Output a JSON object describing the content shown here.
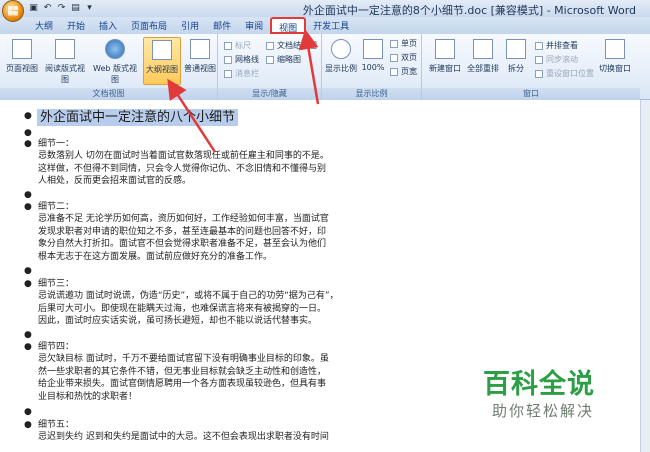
{
  "window": {
    "title": "外企面试中一定注意的8个小细节.doc [兼容模式] - Microsoft Word"
  },
  "ribbon_tabs": [
    "开始",
    "插入",
    "页面布局",
    "引用",
    "邮件",
    "审阅",
    "视图",
    "开发工具"
  ],
  "first_tab": "大纲",
  "active_tab": "视图",
  "groups": {
    "doc_views": {
      "label": "文档视图",
      "buttons": [
        "页面视图",
        "阅读版式视图",
        "Web 版式视图",
        "大纲视图",
        "普通视图"
      ],
      "selected": "大纲视图"
    },
    "show_hide": {
      "label": "显示/隐藏",
      "items": [
        "标尺",
        "网格线",
        "消息栏",
        "文档结构图",
        "缩略图"
      ]
    },
    "zoom": {
      "label": "显示比例",
      "buttons": [
        "显示比例",
        "100%"
      ],
      "small": [
        "单页",
        "双页",
        "页宽"
      ]
    },
    "window": {
      "label": "窗口",
      "buttons": [
        "新建窗口",
        "全部重排",
        "拆分",
        "切换窗口"
      ],
      "small": [
        "并排查看",
        "同步滚动",
        "重设窗口位置"
      ]
    }
  },
  "document": {
    "heading": "外企面试中一定注意的八个小细节",
    "sections": [
      {
        "title": "细节一：",
        "lines": [
          "忌数落别人  切勿在面试时当着面试官数落现任或前任雇主和同事的不是。",
          "这样做，不但得不到同情，只会令人觉得你记仇、不念旧情和不懂得与别",
          "人相处，反而更会招来面试官的反感。"
        ]
      },
      {
        "title": "细节二：",
        "lines": [
          "忌准备不足  无论学历如何高，资历如何好，工作经验如何丰富，当面试官",
          "发现求职者对申请的职位知之不多，甚至连最基本的问题也回答不好，印",
          "象分自然大打折扣。面试官不但会觉得求职者准备不足，甚至会认为他们",
          "根本无志于在这方面发展。面试前应做好充分的准备工作。"
        ]
      },
      {
        "title": "细节三：",
        "lines": [
          "忌说谎邀功  面试时说谎，伪造“历史”，或将不属于自己的功劳“据为己有”，",
          "后果可大可小。即使现在能瞒天过海，也难保谎言将来有被揭穿的一日。",
          "因此，面试时应实话实说，虽可扬长避短，却也不能以说话代替事实。"
        ]
      },
      {
        "title": "细节四：",
        "lines": [
          "忌欠缺目标  面试时，千万不要给面试官留下没有明确事业目标的印象。虽",
          "然一些求职者的其它条件不错，但无事业目标就会缺乏主动性和创造性，",
          "给企业带来损失。面试官倒情愿聘用一个各方面表现虽较逊色，但具有事",
          "业目标和热忱的求职者！"
        ]
      },
      {
        "title": "细节五：",
        "lines": [
          "忌迟到失约  迟到和失约是面试中的大忌。这不但会表现出求职者没有时间"
        ]
      }
    ]
  },
  "watermark": {
    "title": "百科全说",
    "subtitle": "助你轻松解决"
  },
  "colors": {
    "annotation": "#e23a3a",
    "selection": "#b7cdeb",
    "watermark_green": "#2c9e45"
  }
}
